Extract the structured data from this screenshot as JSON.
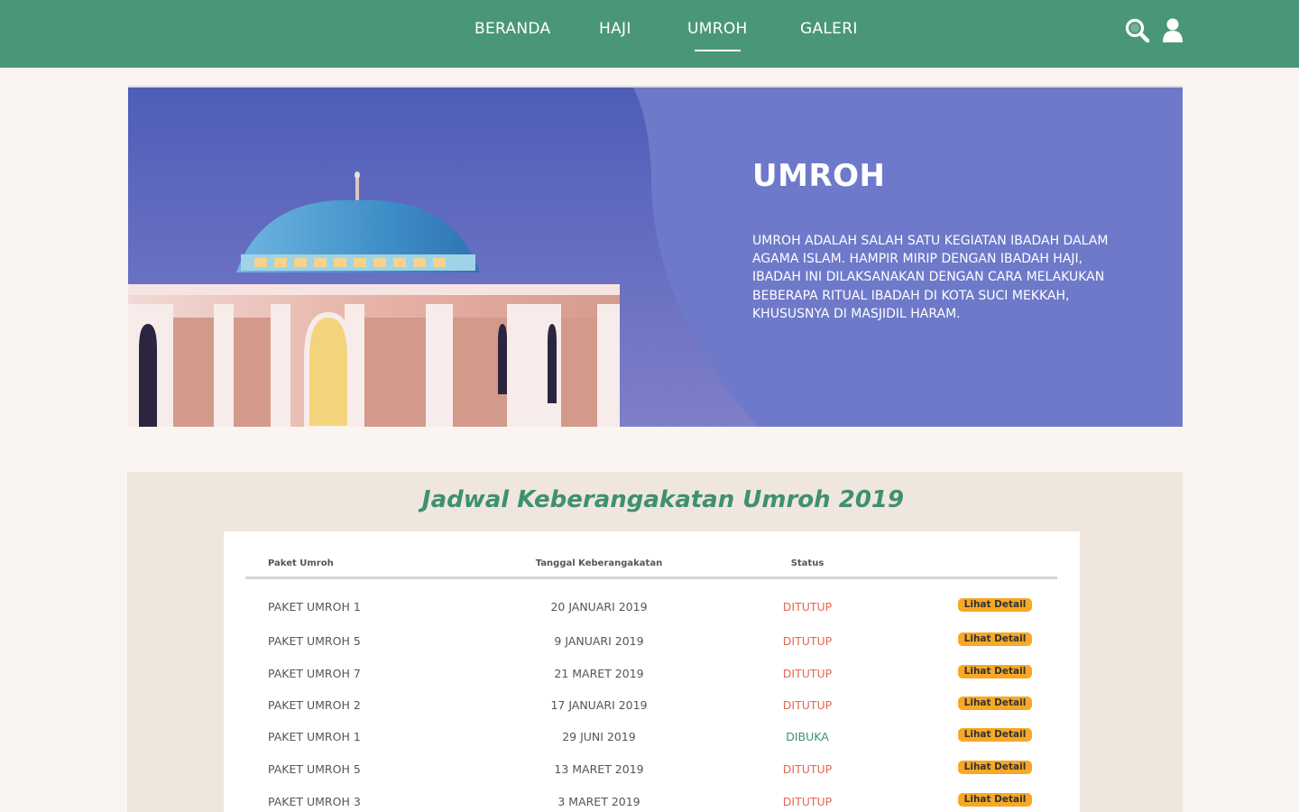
{
  "nav": {
    "items": [
      {
        "label": "BERANDA",
        "active": false
      },
      {
        "label": "HAJI",
        "active": false
      },
      {
        "label": "UMROH",
        "active": true
      },
      {
        "label": "GALERI",
        "active": false
      }
    ],
    "icons": [
      "search-icon",
      "user-icon"
    ]
  },
  "hero": {
    "title": "UMROH",
    "description": "UMROH ADALAH SALAH SATU KEGIATAN IBADAH DALAM AGAMA ISLAM. HAMPIR MIRIP DENGAN IBADAH HAJI, IBADAH INI DILAKSANAKAN DENGAN CARA MELAKUKAN BEBERAPA RITUAL IBADAH DI KOTA SUCI MEKKAH, KHUSUSNYA DI MASJIDIL HARAM."
  },
  "schedule": {
    "title": "Jadwal Keberangakatan Umroh 2019",
    "headers": {
      "paket": "Paket Umroh",
      "tanggal": "Tanggal Keberangakatan",
      "status": "Status"
    },
    "rows": [
      {
        "paket": "PAKET UMROH 1",
        "tanggal": "20 JANUARI 2019",
        "status": "DITUTUP",
        "button": "Lihat Detail"
      },
      {
        "paket": "PAKET UMROH 5",
        "tanggal": "9 JANUARI 2019",
        "status": "DITUTUP",
        "button": "Lihat Detail"
      },
      {
        "paket": "PAKET UMROH 7",
        "tanggal": "21 MARET 2019",
        "status": "DITUTUP",
        "button": "Lihat Detail"
      },
      {
        "paket": "PAKET UMROH 2",
        "tanggal": "17 JANUARI 2019",
        "status": "DITUTUP",
        "button": "Lihat Detail"
      },
      {
        "paket": "PAKET UMROH 1",
        "tanggal": "29 JUNI 2019",
        "status": "DIBUKA",
        "button": "Lihat Detail"
      },
      {
        "paket": "PAKET UMROH 5",
        "tanggal": "13 MARET 2019",
        "status": "DITUTUP",
        "button": "Lihat Detail"
      },
      {
        "paket": "PAKET UMROH 3",
        "tanggal": "3 MARET 2019",
        "status": "DITUTUP",
        "button": "Lihat Detail"
      }
    ]
  },
  "colors": {
    "nav_bg": "#4a9778",
    "hero_bg": "#6e79c9",
    "accent_green": "#3f9070",
    "status_closed": "#e8664f",
    "button_bg": "#f7a825",
    "page_bg": "#faf5f0",
    "section_bg": "#efe6dd"
  }
}
